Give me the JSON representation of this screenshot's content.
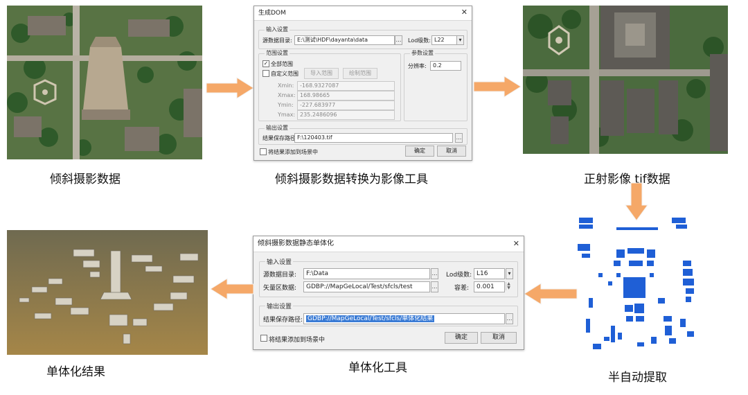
{
  "captions": {
    "oblique": "倾斜摄影数据",
    "tool1": "倾斜摄影数据转换为影像工具",
    "ortho": "正射影像 tif数据",
    "extract": "半自动提取",
    "tool2": "单体化工具",
    "result": "单体化结果"
  },
  "colors": {
    "arrow": "#f5a868",
    "arrow_edge": "#f2f2f2",
    "footprints": "#1f5fd6",
    "selection": "#3a7bd5",
    "terrain": "#a58648"
  },
  "dialog_dom": {
    "title": "生成DOM",
    "close": "✕",
    "input_group": "输入设置",
    "source_label": "源数据目录:",
    "source_value": "E:\\测试\\HDF\\dayanta\\data",
    "lod_label": "Lod级数:",
    "lod_value": "L22",
    "range_group": "范围设置",
    "checkbox_all": "全部范围",
    "checkbox_custom": "自定义范围",
    "import_btn": "导入范围",
    "draw_btn": "绘制范围",
    "xmin_label": "Xmin:",
    "xmin_value": "-168.9327087",
    "xmax_label": "Xmax:",
    "xmax_value": "168.98665",
    "ymin_label": "Ymin:",
    "ymin_value": "-227.683977",
    "ymax_label": "Ymax:",
    "ymax_value": "235.2486096",
    "param_group": "参数设置",
    "res_label": "分辨率:",
    "res_value": "0.2",
    "output_group": "输出设置",
    "save_label": "结果保存路径:",
    "save_value": "F:\\120403.tif",
    "add_scene": "将结果添加到场景中",
    "ok": "确定",
    "cancel": "取消"
  },
  "dialog_mono": {
    "title": "倾斜摄影数据静态单体化",
    "close": "✕",
    "input_group": "输入设置",
    "source_label": "源数据目录:",
    "source_value": "F:\\Data",
    "lod_label": "Lod级数:",
    "lod_value": "L16",
    "vector_label": "矢量区数据:",
    "vector_value": "GDBP://MapGeLocal/Test/sfcls/test",
    "tol_label": "容差:",
    "tol_value": "0.001",
    "output_group": "输出设置",
    "save_label": "结果保存路径:",
    "save_value": "GDBP://MapGeLocal/Test/sfcls/单体化结果",
    "add_scene": "将结果添加到场景中",
    "ok": "确定",
    "cancel": "取消"
  }
}
